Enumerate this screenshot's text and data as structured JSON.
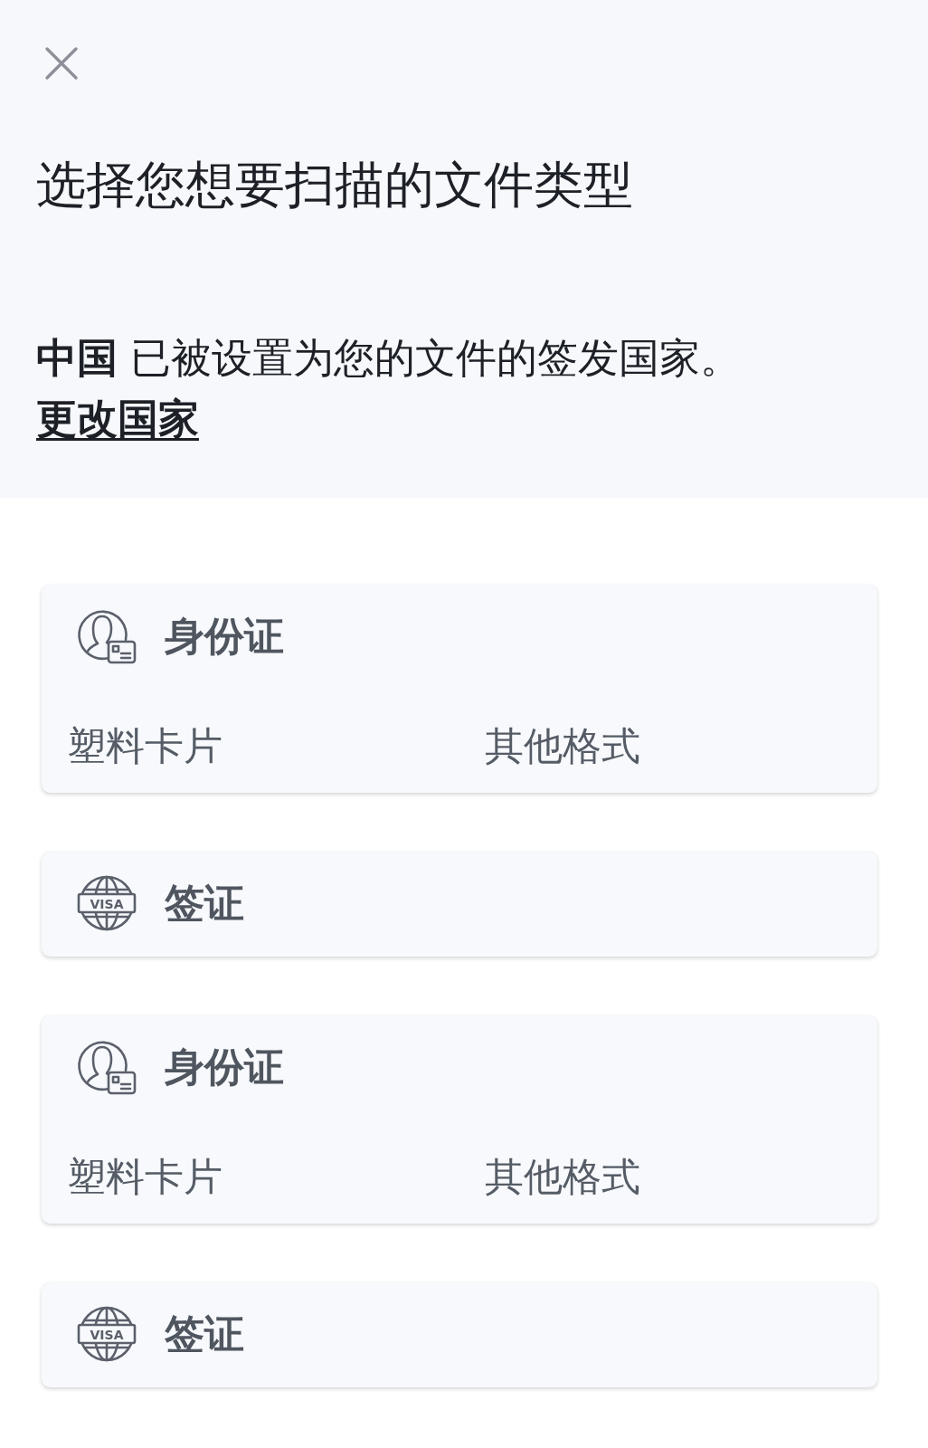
{
  "header": {
    "title": "选择您想要扫描的文件类型",
    "notice": {
      "text": "**中国** 已被设置为您的文件的签发国家。",
      "link": "更改国家"
    }
  },
  "document_types": [
    {
      "kind": "id_card",
      "title": "身份证",
      "options": [
        "塑料卡片",
        "其他格式"
      ]
    },
    {
      "kind": "visa",
      "title": "签证",
      "icon_label": "VISA"
    },
    {
      "kind": "id_card",
      "title": "身份证",
      "options": [
        "塑料卡片",
        "其他格式"
      ]
    },
    {
      "kind": "visa",
      "title": "签证",
      "icon_label": "VISA"
    }
  ]
}
